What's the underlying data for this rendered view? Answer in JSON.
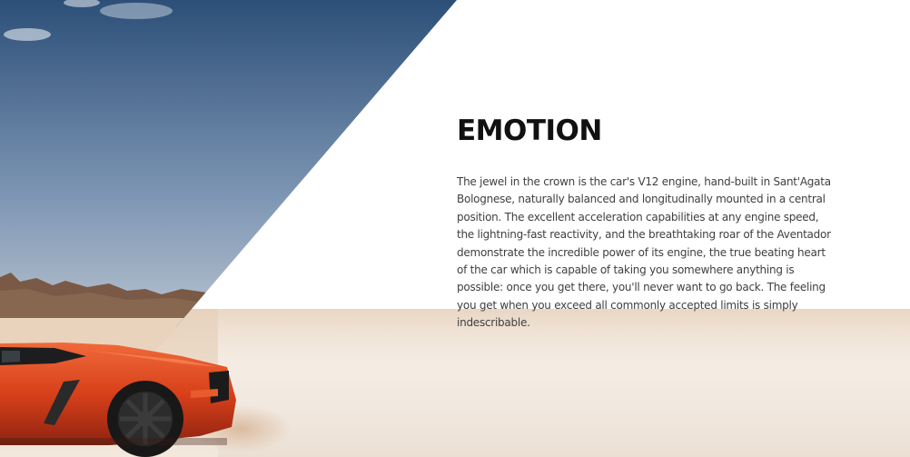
{
  "section": {
    "title": "EMOTION",
    "body": "The jewel in the crown is the car's V12 engine, hand-built in Sant'Agata Bolognese, naturally balanced and longitudinally mounted in a central position.  The excellent acceleration capabilities at any engine speed, the lightning-fast reactivity, and the breathtaking roar of the Aventador demonstrate the incredible power of its engine, the true beating heart of the car which is capable of taking you somewhere anything is possible: once you get there, you'll never want to go back. The feeling you get when you exceed all commonly accepted limits is simply indescribable."
  },
  "hero": {
    "image": "orange-lamborghini-in-desert",
    "colors": {
      "sky_top": "#2c4f78",
      "sky_bottom": "#a9b8c8",
      "sand": "#e9d8c6",
      "car": "#d8401a"
    }
  }
}
